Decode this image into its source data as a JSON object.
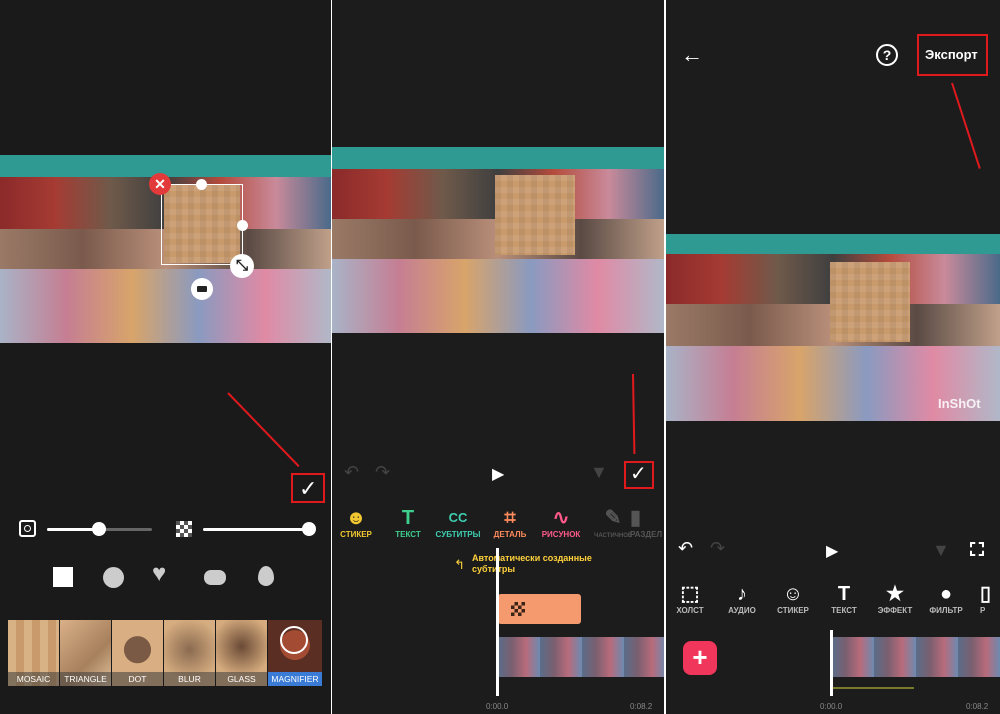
{
  "panel1": {
    "filters": [
      {
        "label": "MOSAIC",
        "selected": false
      },
      {
        "label": "TRIANGLE",
        "selected": false
      },
      {
        "label": "DOT",
        "selected": false
      },
      {
        "label": "BLUR",
        "selected": false
      },
      {
        "label": "GLASS",
        "selected": false
      },
      {
        "label": "MAGNIFIER",
        "selected": true
      }
    ],
    "shapes": [
      "square-shape-icon",
      "circle-shape-icon",
      "heart-shape-icon",
      "rounded-rect-shape-icon",
      "drop-shape-icon"
    ],
    "size_slider_level": 0.4,
    "strength_slider_level": 1.0
  },
  "panel2": {
    "tools": [
      {
        "label": "СТИКЕР",
        "icon": "☻",
        "color": "#f2c832"
      },
      {
        "label": "ТЕКСТ",
        "icon": "T",
        "color": "#3ecf8e"
      },
      {
        "label": "СУБТИТРЫ",
        "icon": "CC",
        "color": "#3ecfb0"
      },
      {
        "label": "ДЕТАЛЬ",
        "icon": "⌗",
        "color": "#ff8a5c"
      },
      {
        "label": "РИСУНОК",
        "icon": "∿",
        "color": "#ff5a8a"
      },
      {
        "label": "ЧАСТИЧНОЕ",
        "icon": "✎",
        "color": "#555555"
      },
      {
        "label": "РАЗДЕЛ",
        "icon": "▮",
        "color": "#555555"
      }
    ],
    "tooltip": "Автоматически созданные субтитры",
    "time_start": "0:00.0",
    "time_end": "0:08.2"
  },
  "panel3": {
    "export_label": "Экспорт",
    "watermark": "InShOt",
    "tools": [
      {
        "label": "ХОЛСТ",
        "icon": "⬚"
      },
      {
        "label": "АУДИО",
        "icon": "♪"
      },
      {
        "label": "СТИКЕР",
        "icon": "☺"
      },
      {
        "label": "ТЕКСТ",
        "icon": "T"
      },
      {
        "label": "ЭФФЕКТ",
        "icon": "★"
      },
      {
        "label": "ФИЛЬТР",
        "icon": "●"
      },
      {
        "label": "Р",
        "icon": "▯"
      }
    ],
    "time_start": "0:00.0",
    "time_end": "0:08.2"
  },
  "colors": {
    "accent_red": "#e0191d",
    "magnifier_blue": "#3a7bd5",
    "add_button": "#f0365a",
    "tooltip_yellow": "#ffd23c"
  }
}
